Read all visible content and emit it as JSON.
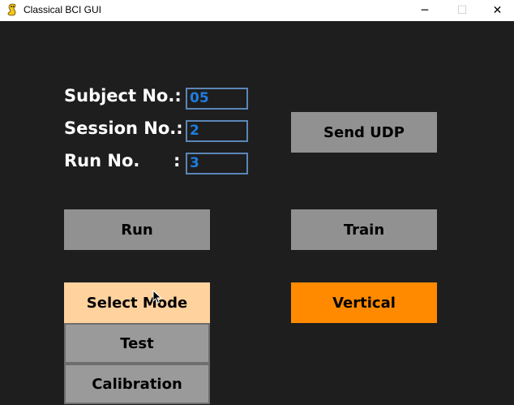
{
  "window": {
    "title": "Classical BCI GUI",
    "minimize_glyph": "─",
    "maximize_glyph": "☐",
    "close_glyph": "✕"
  },
  "fields": {
    "subject_label": "Subject No.:",
    "subject_value": "05",
    "session_label": "Session No.:",
    "session_value": "2",
    "run_label": "Run No.",
    "run_colon": ":",
    "run_value": "3"
  },
  "buttons": {
    "send_udp": "Send UDP",
    "run": "Run",
    "train": "Train",
    "select_mode": "Select Mode",
    "vertical": "Vertical"
  },
  "mode_dropdown": {
    "options": [
      "Test",
      "Calibration"
    ]
  },
  "colors": {
    "background": "#1e1e1e",
    "button_gray": "#919191",
    "select_active": "#ffd29e",
    "vertical_orange": "#ff8a00",
    "field_text": "#1f7de0",
    "field_border": "#5b86b8"
  }
}
